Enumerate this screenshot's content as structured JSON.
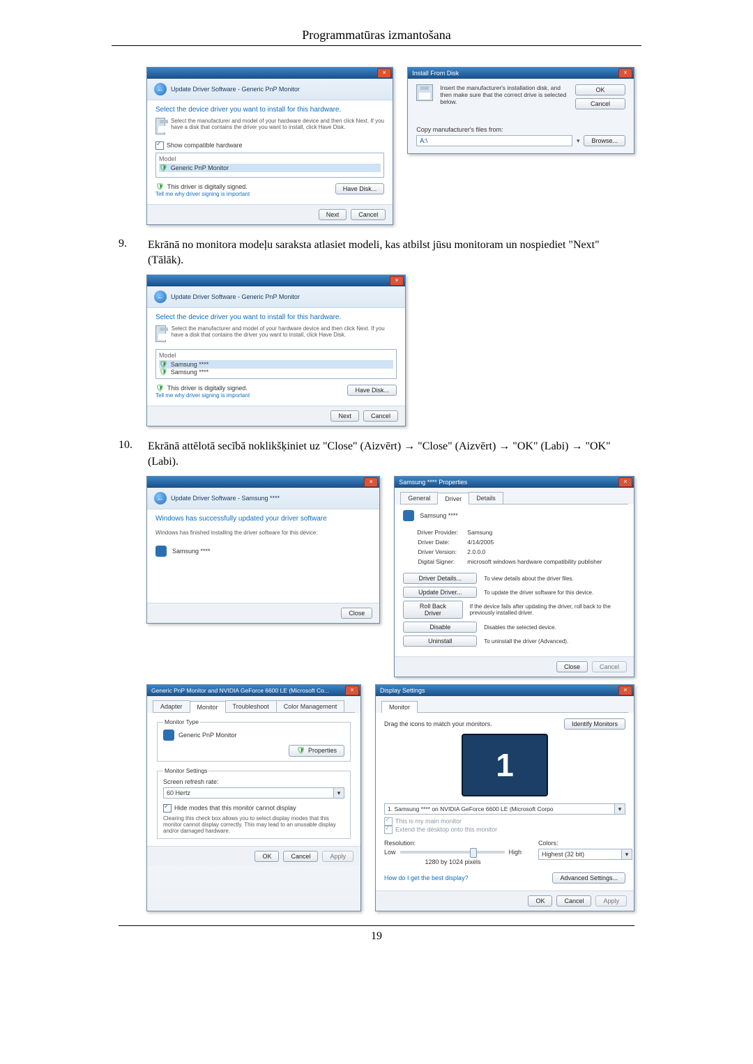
{
  "doc": {
    "header": "Programmatūras izmantošana",
    "step9_num": "9.",
    "step9_text": "Ekrānā no monitora modeļu saraksta atlasiet modeli, kas atbilst jūsu monitoram un nospiediet \"Next\" (Tālāk).",
    "step10_num": "10.",
    "step10_text": "Ekrānā attēlotā secībā noklikšķiniet uz \"Close\" (Aizvērt) → \"Close\" (Aizvērt) → \"OK\" (Labi) → \"OK\" (Labi).",
    "page_number": "19"
  },
  "updateDriver1": {
    "bread": "Update Driver Software - Generic PnP Monitor",
    "h1": "Select the device driver you want to install for this hardware.",
    "desc": "Select the manufacturer and model of your hardware device and then click Next. If you have a disk that contains the driver you want to install, click Have Disk.",
    "show_compat": "Show compatible hardware",
    "col_model": "Model",
    "row1": "Generic PnP Monitor",
    "signed": "This driver is digitally signed.",
    "tell": "Tell me why driver signing is important",
    "have_disk": "Have Disk...",
    "next": "Next",
    "cancel": "Cancel"
  },
  "installFromDisk": {
    "title": "Install From Disk",
    "instr": "Insert the manufacturer's installation disk, and then make sure that the correct drive is selected below.",
    "ok": "OK",
    "cancel": "Cancel",
    "copy": "Copy manufacturer's files from:",
    "path": "A:\\",
    "browse": "Browse..."
  },
  "updateDriver2": {
    "bread": "Update Driver Software - Generic PnP Monitor",
    "h1": "Select the device driver you want to install for this hardware.",
    "desc": "Select the manufacturer and model of your hardware device and then click Next. If you have a disk that contains the driver you want to install, click Have Disk.",
    "col_model": "Model",
    "row1": "Samsung ****",
    "row2": "Samsung ****",
    "signed": "This driver is digitally signed.",
    "tell": "Tell me why driver signing is important",
    "have_disk": "Have Disk...",
    "next": "Next",
    "cancel": "Cancel"
  },
  "updateDone": {
    "bread": "Update Driver Software - Samsung ****",
    "h1": "Windows has successfully updated your driver software",
    "sub": "Windows has finished installing the driver software for this device:",
    "device": "Samsung ****",
    "close": "Close"
  },
  "props": {
    "title": "Samsung **** Properties",
    "tab_general": "General",
    "tab_driver": "Driver",
    "tab_details": "Details",
    "device": "Samsung ****",
    "lbl_provider": "Driver Provider:",
    "val_provider": "Samsung",
    "lbl_date": "Driver Date:",
    "val_date": "4/14/2005",
    "lbl_version": "Driver Version:",
    "val_version": "2.0.0.0",
    "lbl_signer": "Digital Signer:",
    "val_signer": "microsoft windows hardware compatibility publisher",
    "btn_details": "Driver Details...",
    "txt_details": "To view details about the driver files.",
    "btn_update": "Update Driver...",
    "txt_update": "To update the driver software for this device.",
    "btn_rollback": "Roll Back Driver",
    "txt_rollback": "If the device fails after updating the driver, roll back to the previously installed driver.",
    "btn_disable": "Disable",
    "txt_disable": "Disables the selected device.",
    "btn_uninstall": "Uninstall",
    "txt_uninstall": "To uninstall the driver (Advanced).",
    "close": "Close",
    "cancel": "Cancel"
  },
  "monitorTab": {
    "title": "Generic PnP Monitor and NVIDIA GeForce 6600 LE (Microsoft Co...",
    "tab_adapter": "Adapter",
    "tab_monitor": "Monitor",
    "tab_trouble": "Troubleshoot",
    "tab_color": "Color Management",
    "grp_type": "Monitor Type",
    "type": "Generic PnP Monitor",
    "btn_props": "Properties",
    "grp_settings": "Monitor Settings",
    "lbl_refresh": "Screen refresh rate:",
    "val_refresh": "60 Hertz",
    "chk_hide": "Hide modes that this monitor cannot display",
    "hide_desc": "Clearing this check box allows you to select display modes that this monitor cannot display correctly. This may lead to an unusable display and/or damaged hardware.",
    "ok": "OK",
    "cancel": "Cancel",
    "apply": "Apply"
  },
  "display": {
    "title": "Display Settings",
    "tab_monitor": "Monitor",
    "drag": "Drag the icons to match your monitors.",
    "identify": "Identify Monitors",
    "mon_num": "1",
    "combo": "1. Samsung **** on NVIDIA GeForce 6600 LE (Microsoft Corpo",
    "chk_main": "This is my main monitor",
    "chk_extend": "Extend the desktop onto this monitor",
    "lbl_res": "Resolution:",
    "low": "Low",
    "high": "High",
    "res_value": "1280 by 1024 pixels",
    "lbl_colors": "Colors:",
    "colors_val": "Highest (32 bit)",
    "best": "How do I get the best display?",
    "adv": "Advanced Settings...",
    "ok": "OK",
    "cancel": "Cancel",
    "apply": "Apply"
  }
}
